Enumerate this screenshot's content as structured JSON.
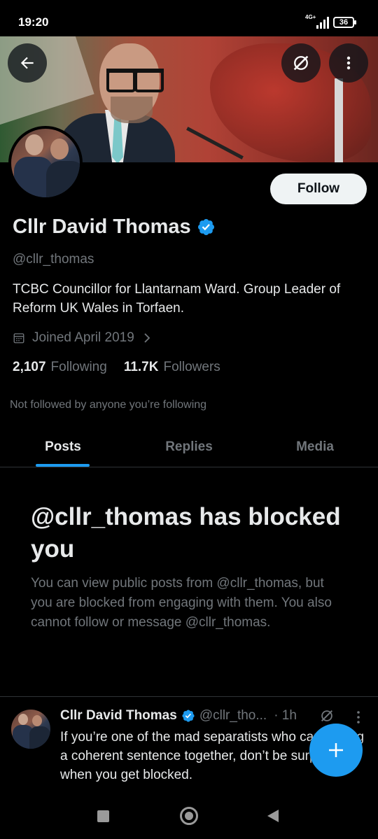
{
  "status_bar": {
    "time": "19:20",
    "network": "4G+",
    "battery": "36"
  },
  "profile": {
    "display_name": "Cllr David Thomas",
    "handle": "@cllr_thomas",
    "bio": "TCBC Councillor for Llantarnam Ward. Group Leader of Reform UK Wales in Torfaen.",
    "joined": "Joined April 2019",
    "following_count": "2,107",
    "following_label": "Following",
    "followers_count": "11.7K",
    "followers_label": "Followers",
    "not_followed_note": "Not followed by anyone you’re following",
    "follow_button": "Follow"
  },
  "tabs": [
    {
      "label": "Posts",
      "active": true
    },
    {
      "label": "Replies",
      "active": false
    },
    {
      "label": "Media",
      "active": false
    }
  ],
  "blocked": {
    "title": "@cllr_thomas has blocked you",
    "description": "You can view public posts from @cllr_thomas, but you are blocked from engaging with them. You also cannot follow or message @cllr_thomas."
  },
  "post": {
    "name": "Cllr David Thomas",
    "handle": "@cllr_tho...",
    "time": "· 1h",
    "text": "If you’re one of the mad separatists who can’t string a coherent sentence together, don’t be surprised when you get blocked."
  },
  "icons": {
    "back": "back-arrow-icon",
    "grok": "grok-icon",
    "more": "more-vertical-icon",
    "verified": "verified-badge-icon",
    "calendar": "calendar-icon",
    "compose": "plus-icon"
  },
  "colors": {
    "accent": "#1d9bf0",
    "background": "#000000",
    "muted": "#71767b",
    "text": "#e7e9ea"
  }
}
